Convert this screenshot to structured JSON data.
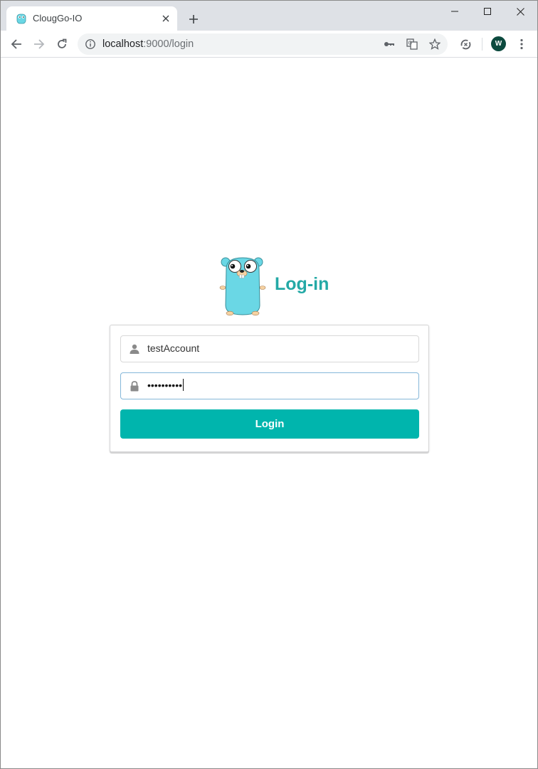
{
  "browser": {
    "tab": {
      "title": "ClougGo-IO",
      "favicon": "gopher-favicon-icon"
    },
    "address_bar": {
      "host": "localhost",
      "rest": ":9000/login"
    },
    "profile_initial": "W"
  },
  "login": {
    "heading": "Log-in",
    "username": {
      "value": "testAccount"
    },
    "password": {
      "masked_value": "••••••••••"
    },
    "button_label": "Login"
  },
  "colors": {
    "accent": "#00b5ad",
    "heading": "#24a9a6",
    "tabstrip": "#dee1e6"
  }
}
